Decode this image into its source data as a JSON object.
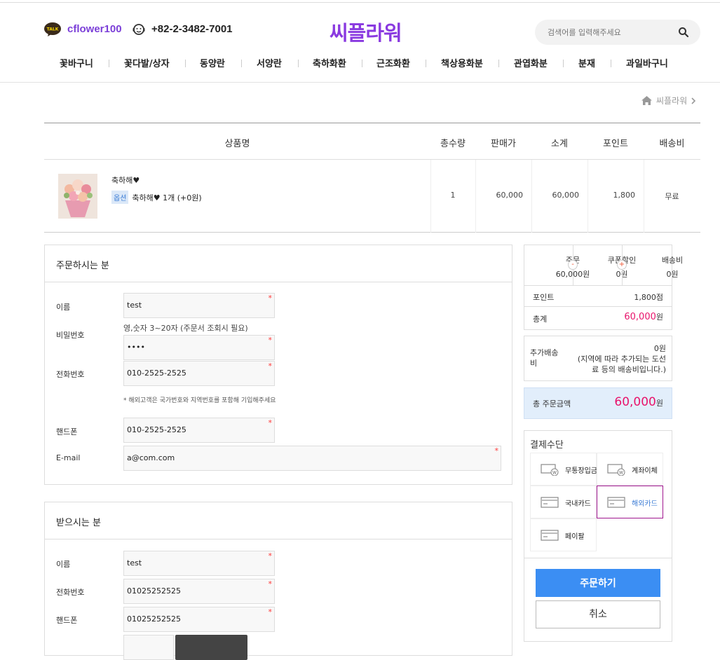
{
  "header": {
    "kakao_badge": "TALK",
    "kakao_id": "cflower100",
    "phone": "+82-2-3482-7001",
    "logo": "씨플라워",
    "search_placeholder": "검색어를 입력해주세요"
  },
  "nav": [
    "꽃바구니",
    "꽃다발/상자",
    "동양란",
    "서양란",
    "축하화환",
    "근조화환",
    "책상용화분",
    "관엽화분",
    "분재",
    "과일바구니"
  ],
  "breadcrumb": "씨플라워",
  "table": {
    "headers": [
      "상품명",
      "총수량",
      "판매가",
      "소계",
      "포인트",
      "배송비"
    ],
    "row": {
      "name": "축하해♥",
      "option_badge": "옵션",
      "option_text": "축하해♥ 1개 (+0원)",
      "qty": "1",
      "price": "60,000",
      "subtotal": "60,000",
      "points": "1,800",
      "shipping": "무료"
    }
  },
  "orderer": {
    "title": "주문하시는 분",
    "name_label": "이름",
    "name_value": "test",
    "password_label": "비밀번호",
    "password_hint": "영,숫자 3~20자 (주문서 조회시 필요)",
    "password_value": "••••",
    "tel_label": "전화번호",
    "tel_value": "010-2525-2525",
    "overseas_note": "* 해외고객은 국가번호와 지역번호를 포함해 기입해주세요",
    "mobile_label": "핸드폰",
    "mobile_value": "010-2525-2525",
    "email_label": "E-mail",
    "email_value": "a@com.com"
  },
  "receiver": {
    "title": "받으시는 분",
    "name_label": "이름",
    "name_value": "test",
    "tel_label": "전화번호",
    "tel_value": "01025252525",
    "mobile_label": "핸드폰",
    "mobile_value": "01025252525"
  },
  "summary": {
    "order_label": "주문",
    "order_value": "60,000원",
    "coupon_label": "쿠폰할인",
    "coupon_value": "0원",
    "ship_label": "배송비",
    "ship_value": "0원",
    "minus": "-",
    "plus": "+",
    "points_label": "포인트",
    "points_value": "1,800점",
    "total_label": "총계",
    "total_value": "60,000",
    "total_unit": "원"
  },
  "extra_shipping": {
    "label": "추가배송비",
    "value": "0원",
    "note": "(지역에 따라 추가되는 도선료 등의 배송비입니다.)"
  },
  "grand_total": {
    "label": "총 주문금액",
    "value": "60,000",
    "unit": "원"
  },
  "payment": {
    "title": "결제수단",
    "methods": [
      "무통장입금",
      "계좌이체",
      "국내카드",
      "해외카드",
      "페이팔"
    ],
    "selected": "해외카드",
    "order_button": "주문하기",
    "cancel_button": "취소"
  },
  "colors": {
    "accent": "#8a3ae0",
    "price_pink": "#e8136b",
    "order_button": "#3b8ef3",
    "selected_border": "#a0168f"
  }
}
